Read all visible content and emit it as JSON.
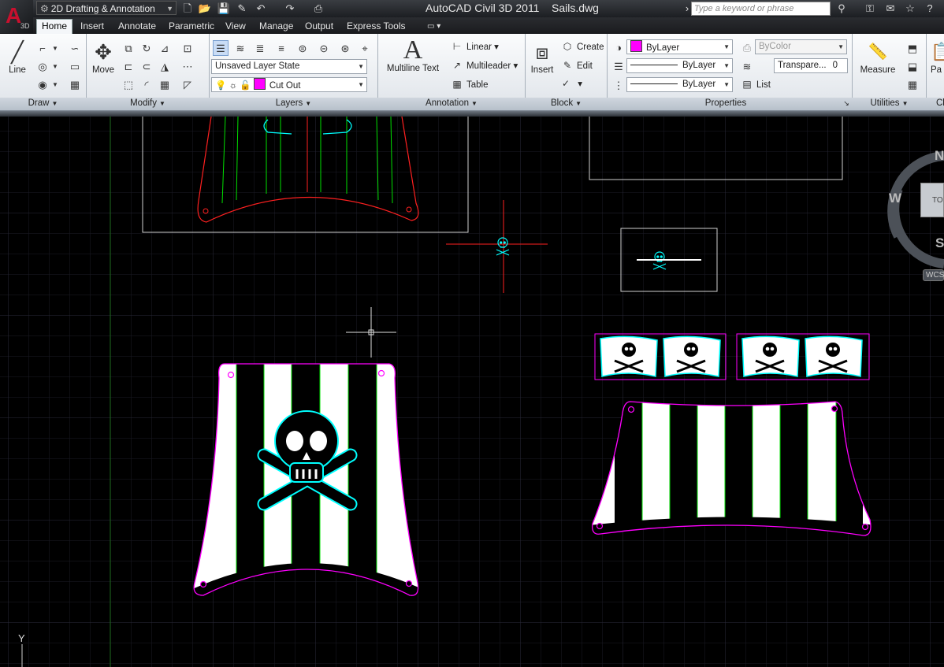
{
  "app": {
    "title": "AutoCAD Civil 3D 2011",
    "document": "Sails.dwg",
    "logo_letter": "A",
    "logo_badge": "3D"
  },
  "workspace": {
    "label": "2D Drafting & Annotation"
  },
  "search": {
    "placeholder": "Type a keyword or phrase"
  },
  "ribbon_tabs": [
    "Home",
    "Insert",
    "Annotate",
    "Parametric",
    "View",
    "Manage",
    "Output",
    "Express Tools"
  ],
  "active_tab": "Home",
  "panels": {
    "draw": {
      "title": "Draw",
      "line_label": "Line"
    },
    "modify": {
      "title": "Modify",
      "move_label": "Move"
    },
    "layers": {
      "title": "Layers",
      "layer_state": "Unsaved Layer State",
      "current_layer": "Cut Out",
      "current_layer_color": "#ff00ff"
    },
    "annotation": {
      "title": "Annotation",
      "multiline_text": "Multiline Text",
      "linear": "Linear",
      "multileader": "Multileader",
      "table": "Table"
    },
    "block": {
      "title": "Block",
      "insert": "Insert",
      "create": "Create",
      "edit": "Edit"
    },
    "properties": {
      "title": "Properties",
      "color": "ByLayer",
      "lineweight": "ByLayer",
      "linetype": "ByLayer",
      "plotstyle": "ByColor",
      "transparency_label": "Transpare...",
      "transparency_value": "0",
      "list": "List"
    },
    "utilities": {
      "title": "Utilities",
      "measure": "Measure"
    },
    "clipboard": {
      "title": "Cl",
      "paste": "Pa"
    }
  },
  "viewcube": {
    "north": "N",
    "west": "W",
    "south": "S",
    "face": "TO",
    "wcs": "WCS"
  },
  "ucs": {
    "y_label": "Y"
  },
  "colors": {
    "sail_outline": "#ff00ff",
    "stripe_edge": "#00ff00",
    "skull": "#00ffff",
    "crosshair": "#ff0000",
    "grid": "#1e1e2e"
  }
}
